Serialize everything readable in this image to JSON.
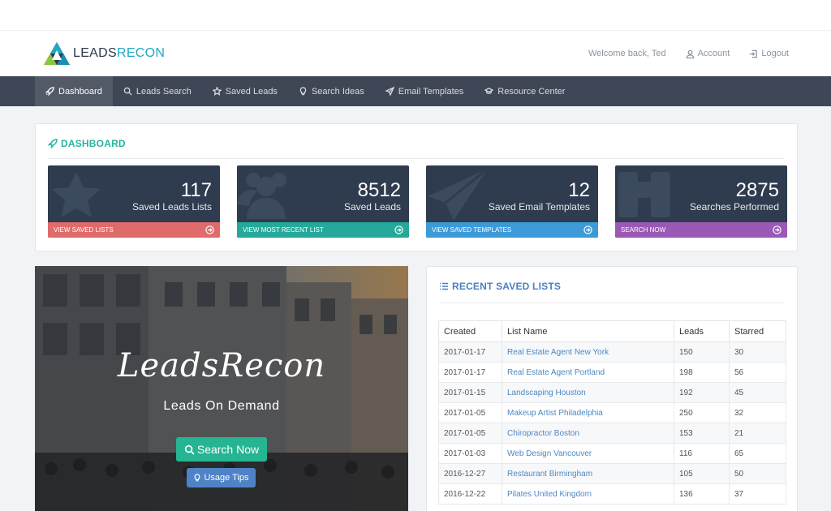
{
  "header": {
    "logo": {
      "part1": "LEADS",
      "part2": "RECON"
    },
    "welcome": "Welcome back, Ted",
    "account_label": "Account",
    "logout_label": "Logout"
  },
  "nav": {
    "items": [
      {
        "label": "Dashboard",
        "icon": "rocket-icon",
        "active": true
      },
      {
        "label": "Leads Search",
        "icon": "search-icon"
      },
      {
        "label": "Saved Leads",
        "icon": "star-icon"
      },
      {
        "label": "Search Ideas",
        "icon": "lightbulb-icon"
      },
      {
        "label": "Email Templates",
        "icon": "paper-plane-icon"
      },
      {
        "label": "Resource Center",
        "icon": "graduation-cap-icon"
      }
    ]
  },
  "dashboard": {
    "title": "DASHBOARD",
    "tiles": [
      {
        "value": "117",
        "label": "Saved Leads Lists",
        "action": "VIEW SAVED LISTS",
        "color": "#e06b6b",
        "icon": "star-icon"
      },
      {
        "value": "8512",
        "label": "Saved Leads",
        "action": "VIEW MOST RECENT LIST",
        "color": "#26a99b",
        "icon": "users-icon"
      },
      {
        "value": "12",
        "label": "Saved Email Templates",
        "action": "VIEW SAVED TEMPLATES",
        "color": "#3d9ad9",
        "icon": "paper-plane-icon"
      },
      {
        "value": "2875",
        "label": "Searches Performed",
        "action": "SEARCH NOW",
        "color": "#9b59b6",
        "icon": "binoculars-icon"
      }
    ]
  },
  "hero": {
    "title": "LeadsRecon",
    "subtitle": "Leads On Demand",
    "search_button": "Search Now",
    "tips_button": "Usage Tips"
  },
  "recent": {
    "title": "RECENT SAVED LISTS",
    "columns": [
      "Created",
      "List Name",
      "Leads",
      "Starred"
    ],
    "rows": [
      [
        "2017-01-17",
        "Real Estate Agent New York",
        "150",
        "30"
      ],
      [
        "2017-01-17",
        "Real Estate Agent Portland",
        "198",
        "56"
      ],
      [
        "2017-01-15",
        "Landscaping Houston",
        "192",
        "45"
      ],
      [
        "2017-01-05",
        "Makeup Artist Philadelphia",
        "250",
        "32"
      ],
      [
        "2017-01-05",
        "Chiropractor Boston",
        "153",
        "21"
      ],
      [
        "2017-01-03",
        "Web Design Vancouver",
        "116",
        "65"
      ],
      [
        "2016-12-27",
        "Restaurant Birmingham",
        "105",
        "50"
      ],
      [
        "2016-12-22",
        "Pilates United Kingdom",
        "136",
        "37"
      ]
    ]
  }
}
